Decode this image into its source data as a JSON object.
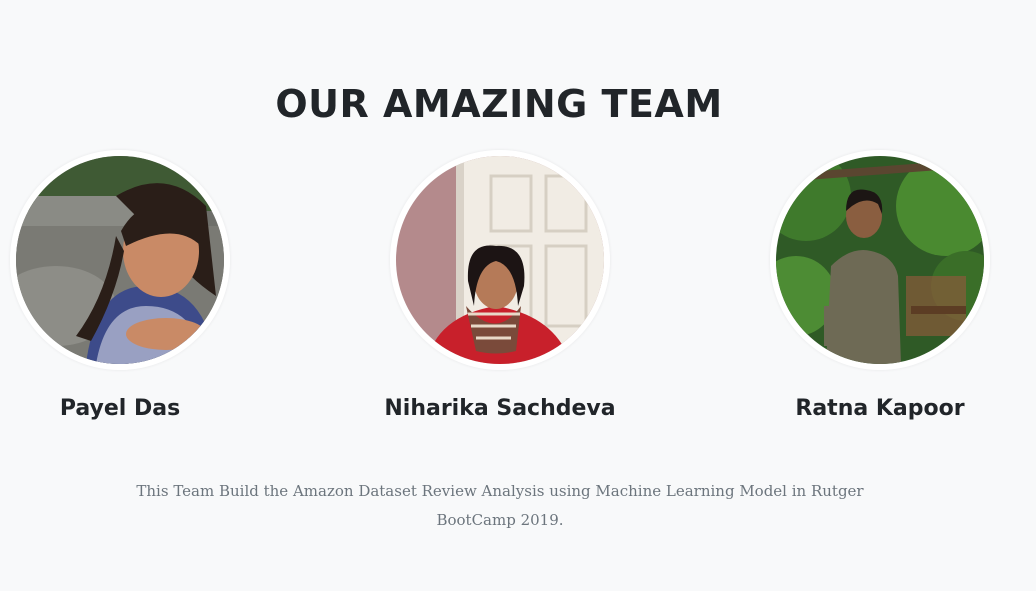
{
  "team": {
    "title": "OUR AMAZING TEAM",
    "members": [
      {
        "name": "Payel Das"
      },
      {
        "name": "Niharika Sachdeva"
      },
      {
        "name": "Ratna Kapoor"
      }
    ],
    "description": "This Team Build the Amazon Dataset Review Analysis using Machine Learning Model in Rutger BootCamp 2019."
  },
  "colors": {
    "background": "#f8f9fa",
    "heading": "#212529",
    "muted_text": "#6c757d",
    "avatar_border": "#ffffff"
  }
}
